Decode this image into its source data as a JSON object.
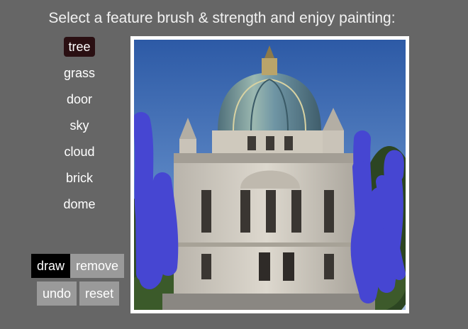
{
  "header": {
    "instruction": "Select a feature brush & strength and enjoy painting:"
  },
  "features": {
    "selected": "tree",
    "items": [
      "tree",
      "grass",
      "door",
      "sky",
      "cloud",
      "brick",
      "dome"
    ]
  },
  "modes": {
    "draw_label": "draw",
    "remove_label": "remove",
    "active": "draw"
  },
  "actions": {
    "undo_label": "undo",
    "reset_label": "reset"
  },
  "colors": {
    "background": "#666666",
    "selected_feature": "#2a0f12",
    "active_button": "#000000",
    "button": "#9a9a9a",
    "brush_stroke": "#4646d2"
  },
  "icons": {
    "canvas_content": "painted-image"
  }
}
